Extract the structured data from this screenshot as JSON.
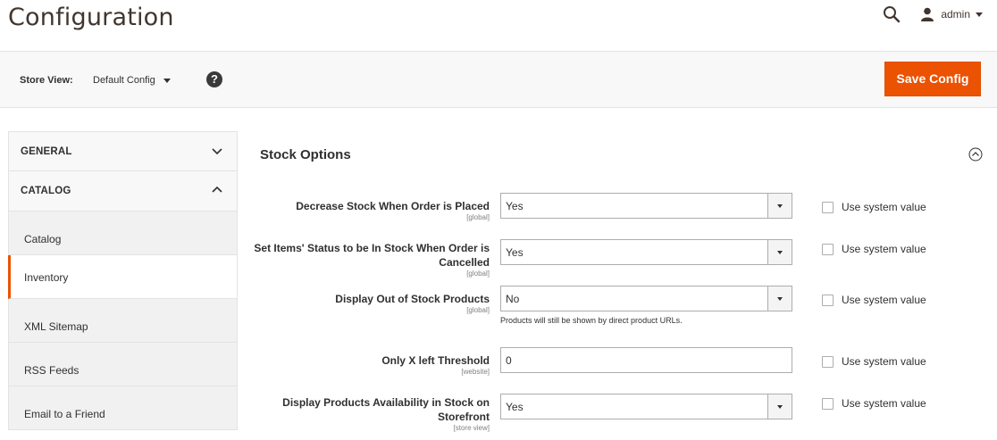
{
  "header": {
    "title": "Configuration",
    "user_name": "admin"
  },
  "toolbar": {
    "store_label": "Store View:",
    "store_value": "Default Config",
    "help_glyph": "?",
    "save_label": "Save Config"
  },
  "sidebar": {
    "groups": [
      {
        "label": "GENERAL",
        "state": "collapsed"
      },
      {
        "label": "CATALOG",
        "state": "expanded"
      }
    ],
    "items": [
      {
        "label": "Catalog",
        "active": false
      },
      {
        "label": "Inventory",
        "active": true
      },
      {
        "label": "XML Sitemap",
        "active": false
      },
      {
        "label": "RSS Feeds",
        "active": false
      },
      {
        "label": "Email to a Friend",
        "active": false
      }
    ]
  },
  "section": {
    "title": "Stock Options",
    "rows": [
      {
        "label": "Decrease Stock When Order is Placed",
        "scope": "[global]",
        "type": "select",
        "value": "Yes",
        "use_system_label": "Use system value"
      },
      {
        "label": "Set Items' Status to be In Stock When Order is Cancelled",
        "scope": "[global]",
        "type": "select",
        "value": "Yes",
        "use_system_label": "Use system value"
      },
      {
        "label": "Display Out of Stock Products",
        "scope": "[global]",
        "type": "select",
        "value": "No",
        "note": "Products will still be shown by direct product URLs.",
        "use_system_label": "Use system value"
      },
      {
        "label": "Only X left Threshold",
        "scope": "[website]",
        "type": "input",
        "value": "0",
        "use_system_label": "Use system value"
      },
      {
        "label": "Display Products Availability in Stock on Storefront",
        "scope": "[store view]",
        "type": "select",
        "value": "Yes",
        "use_system_label": "Use system value"
      }
    ]
  },
  "colors": {
    "accent": "#eb5202",
    "text": "#303030",
    "title": "#41362f"
  }
}
